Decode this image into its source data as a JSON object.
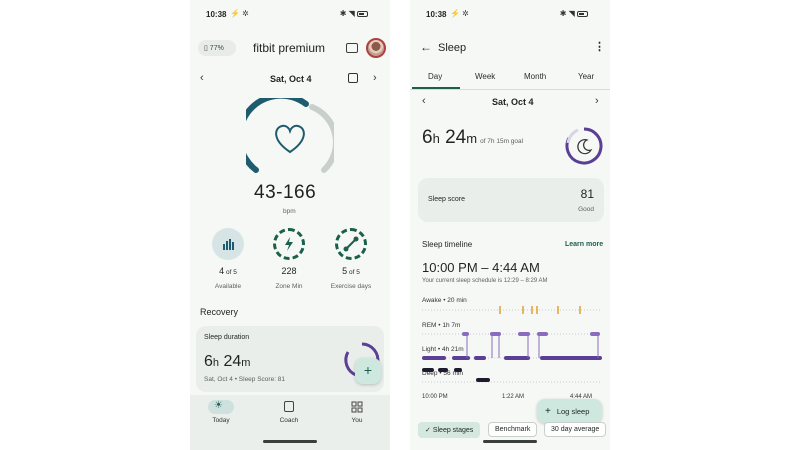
{
  "left_screen": {
    "status_time": "10:38",
    "battery_badge": "77%",
    "brand": "fitbit premium",
    "date": "Sat, Oct 4",
    "heart_rate": {
      "range": "43-166",
      "unit": "bpm"
    },
    "stats": [
      {
        "value": "4",
        "suffix": " of 5",
        "label": "Available"
      },
      {
        "value": "228",
        "suffix": "",
        "label": "Zone Min"
      },
      {
        "value": "5",
        "suffix": " of 5",
        "label": "Exercise days"
      }
    ],
    "section_title": "Recovery",
    "sleep_card": {
      "title": "Sleep duration",
      "hours": "6",
      "h_unit": "h",
      "minutes": "24",
      "m_unit": "m",
      "subtitle": "Sat, Oct 4 • Sleep Score: 81"
    },
    "fab": "+",
    "nav": [
      {
        "label": "Today",
        "icon": "sun-icon"
      },
      {
        "label": "Coach",
        "icon": "clipboard-icon"
      },
      {
        "label": "You",
        "icon": "grid-icon"
      }
    ]
  },
  "right_screen": {
    "status_time": "10:38",
    "title": "Sleep",
    "tabs": [
      "Day",
      "Week",
      "Month",
      "Year"
    ],
    "date": "Sat, Oct 4",
    "duration": {
      "hours": "6",
      "h_unit": "h",
      "minutes": "24",
      "m_unit": "m",
      "goal": "of 7h 15m goal"
    },
    "score_card": {
      "label": "Sleep score",
      "value": "81",
      "rating": "Good"
    },
    "timeline": {
      "title": "Sleep timeline",
      "link": "Learn more",
      "range": "10:00 PM – 4:44 AM",
      "schedule": "Your current sleep schedule is 12:29 – 8:29 AM",
      "stages": [
        {
          "label": "Awake • 20 min"
        },
        {
          "label": "REM • 1h 7m"
        },
        {
          "label": "Light • 4h 21m"
        },
        {
          "label": "Deep • 56 min"
        }
      ],
      "ticks": [
        "10:00 PM",
        "1:22 AM",
        "4:44 AM"
      ]
    },
    "log_button": "Log sleep",
    "chips": [
      "Sleep stages",
      "Benchmark",
      "30 day average"
    ]
  },
  "colors": {
    "accent": "#1b5f4c",
    "ring_dark": "#1e5b6e",
    "ring_light": "#c9cfcb",
    "rem": "#8a6bc0",
    "light": "#5b3f95",
    "deep": "#1f1a2e",
    "awake": "#e0a030"
  }
}
